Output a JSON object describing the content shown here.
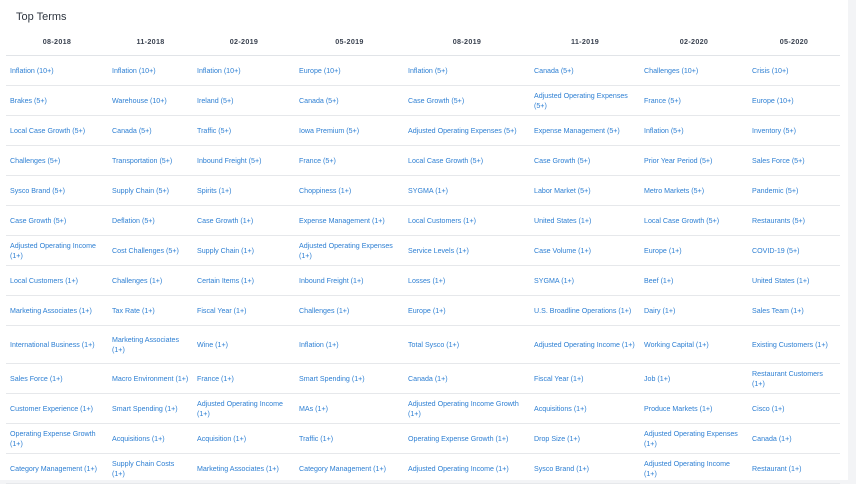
{
  "title": "Top Terms",
  "columns": [
    "08-2018",
    "11-2018",
    "02-2019",
    "05-2019",
    "08-2019",
    "11-2019",
    "02-2020",
    "05-2020"
  ],
  "rows": [
    [
      "Inflation (10+)",
      "Inflation (10+)",
      "Inflation (10+)",
      "Europe (10+)",
      "Inflation (5+)",
      "Canada (5+)",
      "Challenges (10+)",
      "Crisis (10+)"
    ],
    [
      "Brakes (5+)",
      "Warehouse (10+)",
      "Ireland (5+)",
      "Canada (5+)",
      "Case Growth (5+)",
      "Adjusted Operating Expenses (5+)",
      "France (5+)",
      "Europe (10+)"
    ],
    [
      "Local Case Growth (5+)",
      "Canada (5+)",
      "Traffic (5+)",
      "Iowa Premium (5+)",
      "Adjusted Operating Expenses (5+)",
      "Expense Management (5+)",
      "Inflation (5+)",
      "Inventory (5+)"
    ],
    [
      "Challenges (5+)",
      "Transportation (5+)",
      "Inbound Freight (5+)",
      "France (5+)",
      "Local Case Growth (5+)",
      "Case Growth (5+)",
      "Prior Year Period (5+)",
      "Sales Force (5+)"
    ],
    [
      "Sysco Brand (5+)",
      "Supply Chain (5+)",
      "Spirits (1+)",
      "Choppiness (1+)",
      "SYGMA (1+)",
      "Labor Market (5+)",
      "Metro Markets (5+)",
      "Pandemic (5+)"
    ],
    [
      "Case Growth (5+)",
      "Deflation (5+)",
      "Case Growth (1+)",
      "Expense Management (1+)",
      "Local Customers (1+)",
      "United States (1+)",
      "Local Case Growth (5+)",
      "Restaurants (5+)"
    ],
    [
      "Adjusted Operating Income (1+)",
      "Cost Challenges (5+)",
      "Supply Chain (1+)",
      "Adjusted Operating Expenses (1+)",
      "Service Levels (1+)",
      "Case Volume (1+)",
      "Europe (1+)",
      "COVID-19 (5+)"
    ],
    [
      "Local Customers (1+)",
      "Challenges (1+)",
      "Certain Items (1+)",
      "Inbound Freight (1+)",
      "Losses (1+)",
      "SYGMA (1+)",
      "Beef (1+)",
      "United States (1+)"
    ],
    [
      "Marketing Associates (1+)",
      "Tax Rate (1+)",
      "Fiscal Year (1+)",
      "Challenges (1+)",
      "Europe (1+)",
      "U.S. Broadline Operations (1+)",
      "Dairy (1+)",
      "Sales Team (1+)"
    ],
    [
      "International Business (1+)",
      "Marketing Associates (1+)",
      "Wine (1+)",
      "Inflation (1+)",
      "Total Sysco (1+)",
      "Adjusted Operating Income (1+)",
      "Working Capital (1+)",
      "Existing Customers (1+)"
    ],
    [
      "Sales Force (1+)",
      "Macro Environment (1+)",
      "France (1+)",
      "Smart Spending (1+)",
      "Canada (1+)",
      "Fiscal Year (1+)",
      "Job (1+)",
      "Restaurant Customers (1+)"
    ],
    [
      "Customer Experience (1+)",
      "Smart Spending (1+)",
      "Adjusted Operating Income (1+)",
      "MAs (1+)",
      "Adjusted Operating Income Growth (1+)",
      "Acquisitions (1+)",
      "Produce Markets (1+)",
      "Cisco (1+)"
    ],
    [
      "Operating Expense Growth (1+)",
      "Acquisitions (1+)",
      "Acquisition (1+)",
      "Traffic (1+)",
      "Operating Expense Growth (1+)",
      "Drop Size (1+)",
      "Adjusted Operating Expenses (1+)",
      "Canada (1+)"
    ],
    [
      "Category Management (1+)",
      "Supply Chain Costs (1+)",
      "Marketing Associates (1+)",
      "Category Management (1+)",
      "Adjusted Operating Income (1+)",
      "Sysco Brand (1+)",
      "Adjusted Operating Income (1+)",
      "Restaurant (1+)"
    ]
  ]
}
